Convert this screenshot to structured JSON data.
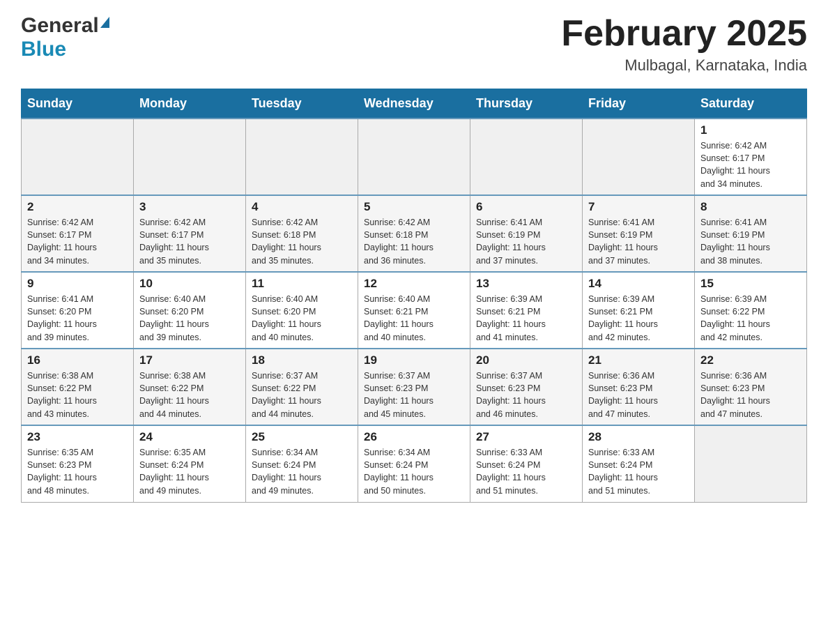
{
  "header": {
    "logo_general": "General",
    "logo_blue": "Blue",
    "month_title": "February 2025",
    "location": "Mulbagal, Karnataka, India"
  },
  "days_of_week": [
    "Sunday",
    "Monday",
    "Tuesday",
    "Wednesday",
    "Thursday",
    "Friday",
    "Saturday"
  ],
  "weeks": [
    [
      {
        "day": "",
        "info": ""
      },
      {
        "day": "",
        "info": ""
      },
      {
        "day": "",
        "info": ""
      },
      {
        "day": "",
        "info": ""
      },
      {
        "day": "",
        "info": ""
      },
      {
        "day": "",
        "info": ""
      },
      {
        "day": "1",
        "info": "Sunrise: 6:42 AM\nSunset: 6:17 PM\nDaylight: 11 hours\nand 34 minutes."
      }
    ],
    [
      {
        "day": "2",
        "info": "Sunrise: 6:42 AM\nSunset: 6:17 PM\nDaylight: 11 hours\nand 34 minutes."
      },
      {
        "day": "3",
        "info": "Sunrise: 6:42 AM\nSunset: 6:17 PM\nDaylight: 11 hours\nand 35 minutes."
      },
      {
        "day": "4",
        "info": "Sunrise: 6:42 AM\nSunset: 6:18 PM\nDaylight: 11 hours\nand 35 minutes."
      },
      {
        "day": "5",
        "info": "Sunrise: 6:42 AM\nSunset: 6:18 PM\nDaylight: 11 hours\nand 36 minutes."
      },
      {
        "day": "6",
        "info": "Sunrise: 6:41 AM\nSunset: 6:19 PM\nDaylight: 11 hours\nand 37 minutes."
      },
      {
        "day": "7",
        "info": "Sunrise: 6:41 AM\nSunset: 6:19 PM\nDaylight: 11 hours\nand 37 minutes."
      },
      {
        "day": "8",
        "info": "Sunrise: 6:41 AM\nSunset: 6:19 PM\nDaylight: 11 hours\nand 38 minutes."
      }
    ],
    [
      {
        "day": "9",
        "info": "Sunrise: 6:41 AM\nSunset: 6:20 PM\nDaylight: 11 hours\nand 39 minutes."
      },
      {
        "day": "10",
        "info": "Sunrise: 6:40 AM\nSunset: 6:20 PM\nDaylight: 11 hours\nand 39 minutes."
      },
      {
        "day": "11",
        "info": "Sunrise: 6:40 AM\nSunset: 6:20 PM\nDaylight: 11 hours\nand 40 minutes."
      },
      {
        "day": "12",
        "info": "Sunrise: 6:40 AM\nSunset: 6:21 PM\nDaylight: 11 hours\nand 40 minutes."
      },
      {
        "day": "13",
        "info": "Sunrise: 6:39 AM\nSunset: 6:21 PM\nDaylight: 11 hours\nand 41 minutes."
      },
      {
        "day": "14",
        "info": "Sunrise: 6:39 AM\nSunset: 6:21 PM\nDaylight: 11 hours\nand 42 minutes."
      },
      {
        "day": "15",
        "info": "Sunrise: 6:39 AM\nSunset: 6:22 PM\nDaylight: 11 hours\nand 42 minutes."
      }
    ],
    [
      {
        "day": "16",
        "info": "Sunrise: 6:38 AM\nSunset: 6:22 PM\nDaylight: 11 hours\nand 43 minutes."
      },
      {
        "day": "17",
        "info": "Sunrise: 6:38 AM\nSunset: 6:22 PM\nDaylight: 11 hours\nand 44 minutes."
      },
      {
        "day": "18",
        "info": "Sunrise: 6:37 AM\nSunset: 6:22 PM\nDaylight: 11 hours\nand 44 minutes."
      },
      {
        "day": "19",
        "info": "Sunrise: 6:37 AM\nSunset: 6:23 PM\nDaylight: 11 hours\nand 45 minutes."
      },
      {
        "day": "20",
        "info": "Sunrise: 6:37 AM\nSunset: 6:23 PM\nDaylight: 11 hours\nand 46 minutes."
      },
      {
        "day": "21",
        "info": "Sunrise: 6:36 AM\nSunset: 6:23 PM\nDaylight: 11 hours\nand 47 minutes."
      },
      {
        "day": "22",
        "info": "Sunrise: 6:36 AM\nSunset: 6:23 PM\nDaylight: 11 hours\nand 47 minutes."
      }
    ],
    [
      {
        "day": "23",
        "info": "Sunrise: 6:35 AM\nSunset: 6:23 PM\nDaylight: 11 hours\nand 48 minutes."
      },
      {
        "day": "24",
        "info": "Sunrise: 6:35 AM\nSunset: 6:24 PM\nDaylight: 11 hours\nand 49 minutes."
      },
      {
        "day": "25",
        "info": "Sunrise: 6:34 AM\nSunset: 6:24 PM\nDaylight: 11 hours\nand 49 minutes."
      },
      {
        "day": "26",
        "info": "Sunrise: 6:34 AM\nSunset: 6:24 PM\nDaylight: 11 hours\nand 50 minutes."
      },
      {
        "day": "27",
        "info": "Sunrise: 6:33 AM\nSunset: 6:24 PM\nDaylight: 11 hours\nand 51 minutes."
      },
      {
        "day": "28",
        "info": "Sunrise: 6:33 AM\nSunset: 6:24 PM\nDaylight: 11 hours\nand 51 minutes."
      },
      {
        "day": "",
        "info": ""
      }
    ]
  ]
}
